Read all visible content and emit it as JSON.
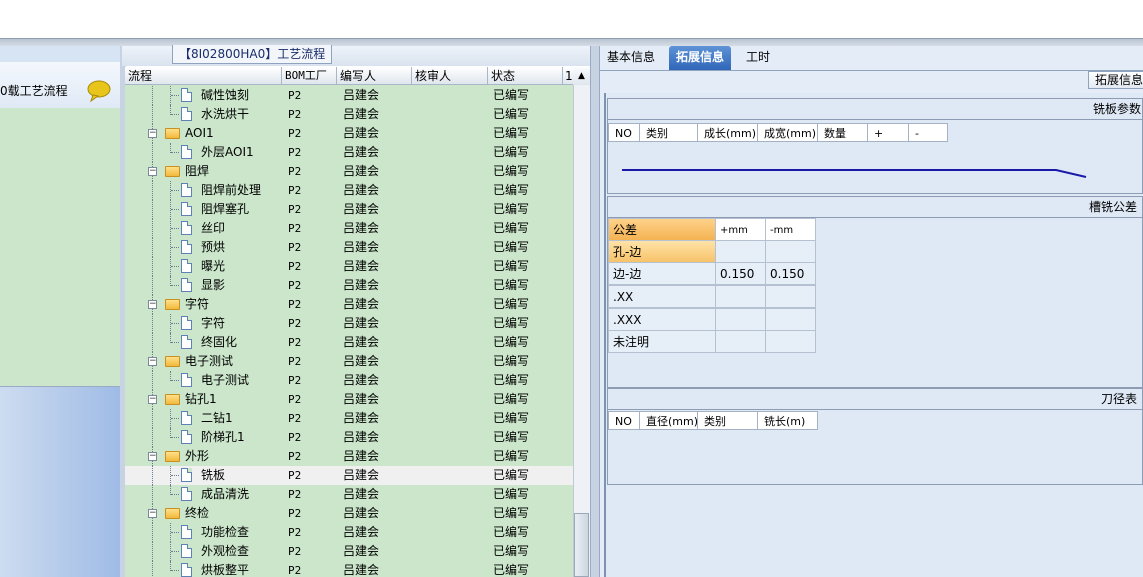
{
  "left": {
    "title": "0载工艺流程",
    "chat_icon": "speech-bubble-icon"
  },
  "middle": {
    "title": "【8I02800HA0】工艺流程",
    "columns": [
      "流程",
      "BOM工厂",
      "编写人",
      "核审人",
      "状态",
      "1"
    ],
    "rows": [
      {
        "level": 2,
        "kind": "doc",
        "name": "碱性蚀刻",
        "bom": "P2",
        "author": "吕建会",
        "reviewer": "",
        "status": "已编写"
      },
      {
        "level": 2,
        "kind": "doc",
        "name": "水洗烘干",
        "bom": "P2",
        "author": "吕建会",
        "reviewer": "",
        "status": "已编写"
      },
      {
        "level": 1,
        "kind": "folder",
        "name": "AOI1",
        "bom": "P2",
        "author": "吕建会",
        "reviewer": "",
        "status": "已编写"
      },
      {
        "level": 2,
        "kind": "doc",
        "name": "外层AOI1",
        "bom": "P2",
        "author": "吕建会",
        "reviewer": "",
        "status": "已编写"
      },
      {
        "level": 1,
        "kind": "folder",
        "name": "阻焊",
        "bom": "P2",
        "author": "吕建会",
        "reviewer": "",
        "status": "已编写"
      },
      {
        "level": 2,
        "kind": "doc",
        "name": "阻焊前处理",
        "bom": "P2",
        "author": "吕建会",
        "reviewer": "",
        "status": "已编写"
      },
      {
        "level": 2,
        "kind": "doc",
        "name": "阻焊塞孔",
        "bom": "P2",
        "author": "吕建会",
        "reviewer": "",
        "status": "已编写"
      },
      {
        "level": 2,
        "kind": "doc",
        "name": "丝印",
        "bom": "P2",
        "author": "吕建会",
        "reviewer": "",
        "status": "已编写"
      },
      {
        "level": 2,
        "kind": "doc",
        "name": "预烘",
        "bom": "P2",
        "author": "吕建会",
        "reviewer": "",
        "status": "已编写"
      },
      {
        "level": 2,
        "kind": "doc",
        "name": "曝光",
        "bom": "P2",
        "author": "吕建会",
        "reviewer": "",
        "status": "已编写"
      },
      {
        "level": 2,
        "kind": "doc",
        "name": "显影",
        "bom": "P2",
        "author": "吕建会",
        "reviewer": "",
        "status": "已编写"
      },
      {
        "level": 1,
        "kind": "folder",
        "name": "字符",
        "bom": "P2",
        "author": "吕建会",
        "reviewer": "",
        "status": "已编写"
      },
      {
        "level": 2,
        "kind": "doc",
        "name": "字符",
        "bom": "P2",
        "author": "吕建会",
        "reviewer": "",
        "status": "已编写"
      },
      {
        "level": 2,
        "kind": "doc",
        "name": "终固化",
        "bom": "P2",
        "author": "吕建会",
        "reviewer": "",
        "status": "已编写"
      },
      {
        "level": 1,
        "kind": "folder",
        "name": "电子测试",
        "bom": "P2",
        "author": "吕建会",
        "reviewer": "",
        "status": "已编写"
      },
      {
        "level": 2,
        "kind": "doc",
        "name": "电子测试",
        "bom": "P2",
        "author": "吕建会",
        "reviewer": "",
        "status": "已编写"
      },
      {
        "level": 1,
        "kind": "folder",
        "name": "钻孔1",
        "bom": "P2",
        "author": "吕建会",
        "reviewer": "",
        "status": "已编写"
      },
      {
        "level": 2,
        "kind": "doc",
        "name": "二钻1",
        "bom": "P2",
        "author": "吕建会",
        "reviewer": "",
        "status": "已编写"
      },
      {
        "level": 2,
        "kind": "doc",
        "name": "阶梯孔1",
        "bom": "P2",
        "author": "吕建会",
        "reviewer": "",
        "status": "已编写"
      },
      {
        "level": 1,
        "kind": "folder",
        "name": "外形",
        "bom": "P2",
        "author": "吕建会",
        "reviewer": "",
        "status": "已编写"
      },
      {
        "level": 2,
        "kind": "doc",
        "name": "铣板",
        "bom": "P2",
        "author": "吕建会",
        "reviewer": "",
        "status": "已编写",
        "selected": true
      },
      {
        "level": 2,
        "kind": "doc",
        "name": "成品清洗",
        "bom": "P2",
        "author": "吕建会",
        "reviewer": "",
        "status": "已编写"
      },
      {
        "level": 1,
        "kind": "folder",
        "name": "终检",
        "bom": "P2",
        "author": "吕建会",
        "reviewer": "",
        "status": "已编写"
      },
      {
        "level": 2,
        "kind": "doc",
        "name": "功能检查",
        "bom": "P2",
        "author": "吕建会",
        "reviewer": "",
        "status": "已编写"
      },
      {
        "level": 2,
        "kind": "doc",
        "name": "外观检查",
        "bom": "P2",
        "author": "吕建会",
        "reviewer": "",
        "status": "已编写"
      },
      {
        "level": 2,
        "kind": "doc",
        "name": "烘板整平",
        "bom": "P2",
        "author": "吕建会",
        "reviewer": "",
        "status": "已编写"
      }
    ]
  },
  "right": {
    "tabs": [
      "基本信息",
      "拓展信息",
      "工时"
    ],
    "active_tab": 1,
    "ext_button": "拓展信息",
    "section1": {
      "title": "铣板参数",
      "columns": [
        "NO",
        "类别",
        "成长(mm)",
        "成宽(mm)",
        "数量",
        "+",
        "-"
      ]
    },
    "section2": {
      "title": "槽铣公差",
      "columns": [
        "公差",
        "+mm",
        "-mm"
      ],
      "rows": [
        [
          "孔-边",
          "",
          ""
        ],
        [
          "边-边",
          "0.150",
          "0.150"
        ],
        [
          ".XX",
          "",
          ""
        ],
        [
          ".XXX",
          "",
          ""
        ],
        [
          "未注明",
          "",
          ""
        ]
      ]
    },
    "section3": {
      "title": "刀径表",
      "columns": [
        "NO",
        "直径(mm)",
        "类别",
        "铣长(m)"
      ]
    },
    "colors": {
      "accent": "#2f66b8",
      "grid_bg": "#cbe6cb",
      "line": "#1a1aa8"
    }
  }
}
